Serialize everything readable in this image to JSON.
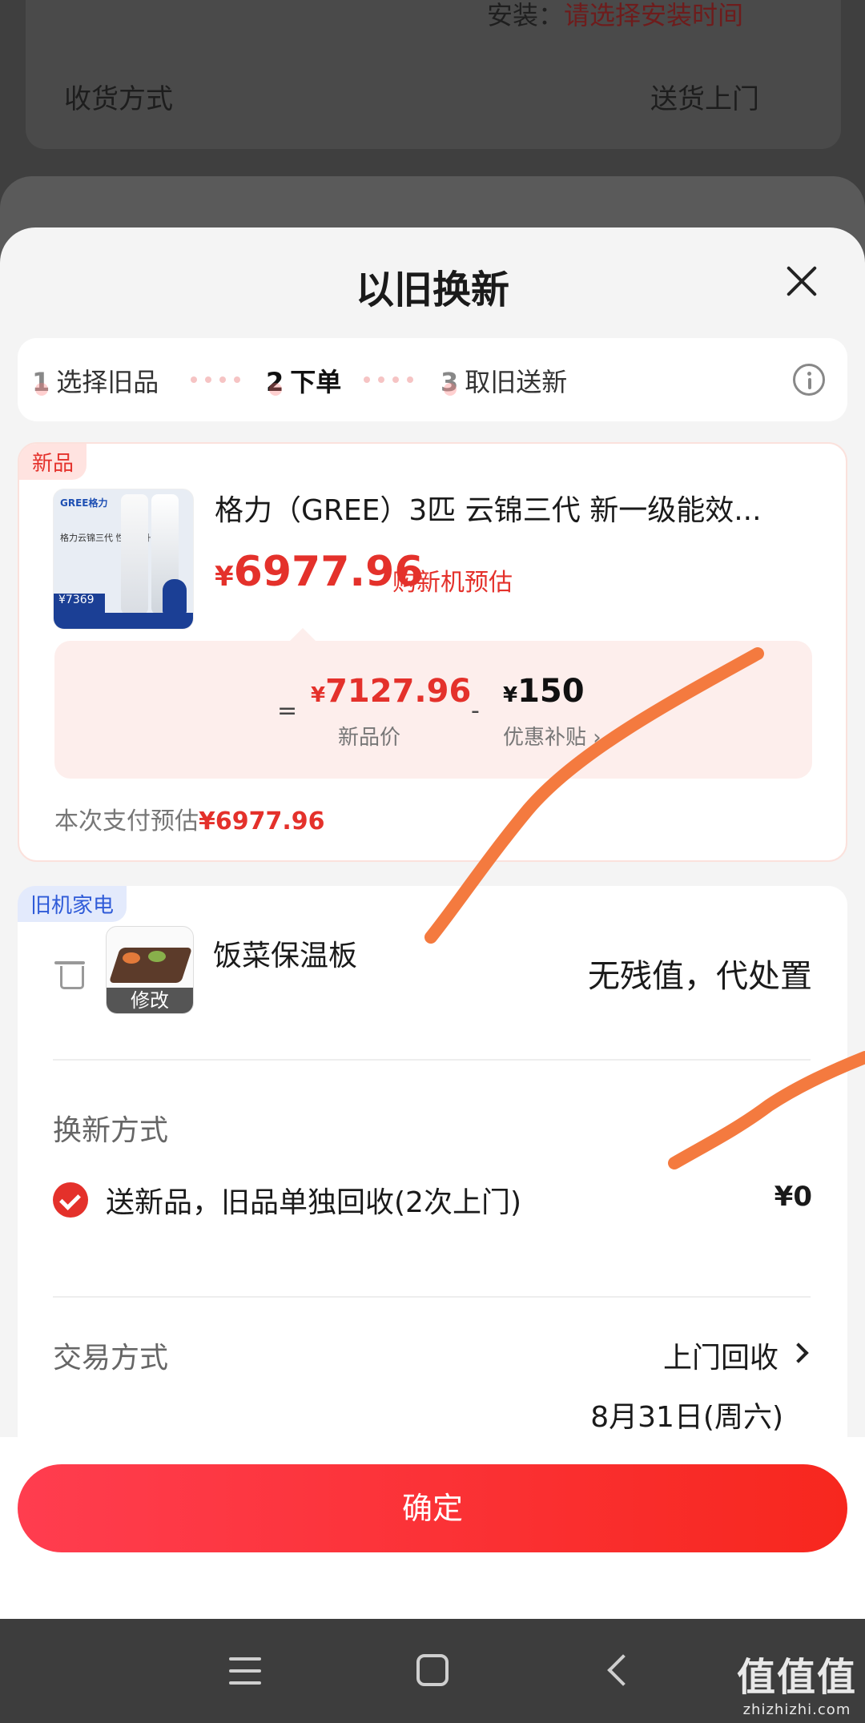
{
  "background": {
    "install_label": "安装：",
    "install_value": "请选择安装时间",
    "shipping_label": "收货方式",
    "shipping_value": "送货上门"
  },
  "sheet": {
    "title": "以旧换新",
    "steps": [
      {
        "num": "1",
        "label": "选择旧品"
      },
      {
        "num": "2",
        "label": "下单"
      },
      {
        "num": "3",
        "label": "取旧送新"
      }
    ]
  },
  "new_product": {
    "tag": "新品",
    "name": "格力（GREE）3匹 云锦三代 新一级能效...",
    "price_yen": "¥",
    "price": "6977.96",
    "price_note": "购新机预估",
    "new_price_yen": "¥",
    "new_price": "7127.96",
    "new_price_label": "新品价",
    "subsidy_yen": "¥",
    "subsidy": "150",
    "subsidy_label": "优惠补贴 ›",
    "pay_label": "本次支付预估",
    "pay_value": "¥6977.96",
    "image": {
      "brand": "GREE格力",
      "text": "格力云锦三代 性能新升级",
      "price_tag": "¥7369"
    }
  },
  "old_product": {
    "tag": "旧机家电",
    "name": "饭菜保温板",
    "modify_label": "修改",
    "value": "无残值，代处置"
  },
  "exchange_method": {
    "label": "换新方式",
    "option": "送新品，旧品单独回收(2次上门)",
    "price": "¥0"
  },
  "trade": {
    "label": "交易方式",
    "value": "上门回收",
    "date": "8月31日(周六)"
  },
  "confirm_label": "确定",
  "watermark": {
    "logo": "值值值",
    "site": "zhizhizhi.com"
  },
  "colors": {
    "accent": "#e4312b",
    "button_start": "#ff3d4f",
    "button_end": "#f7271e",
    "old_tag": "#2f5bd8",
    "scribble": "#f47a3f"
  }
}
